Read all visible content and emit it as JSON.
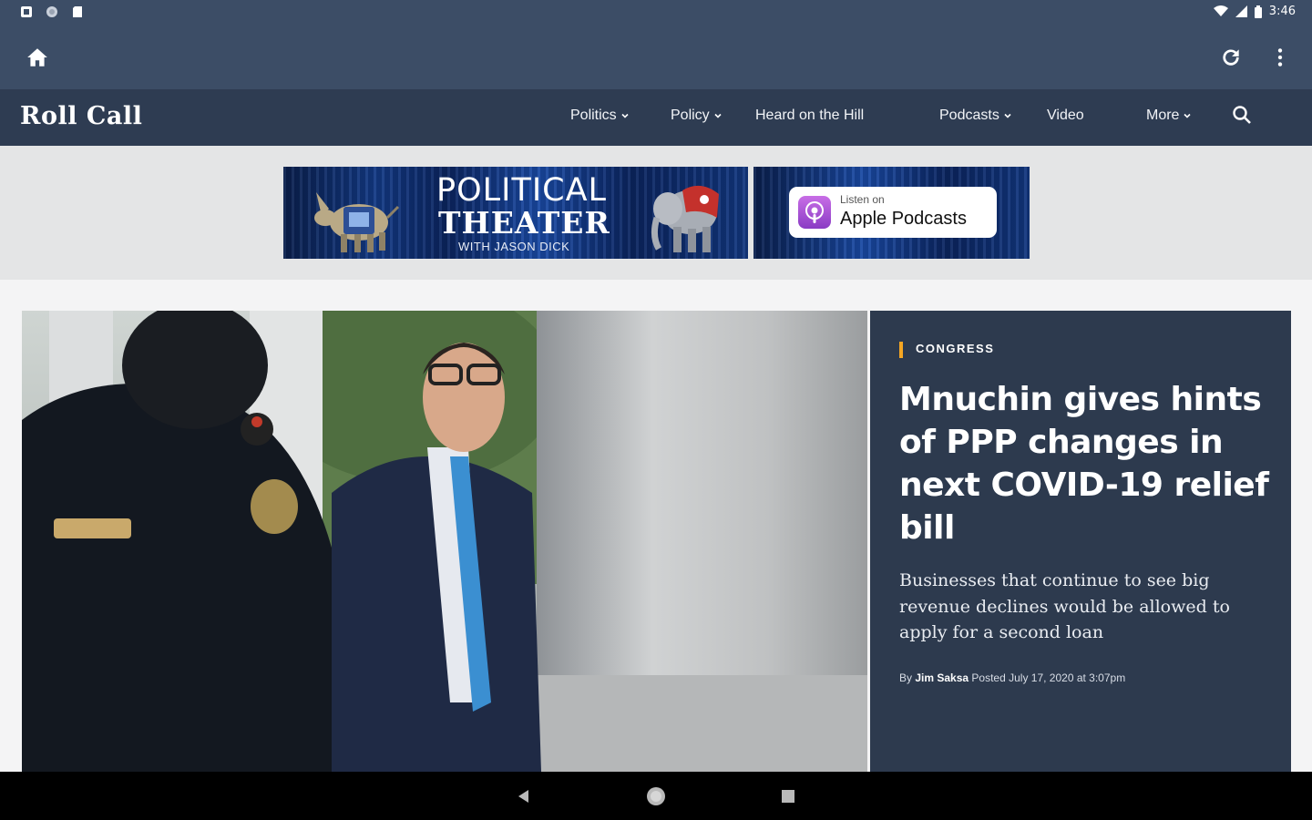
{
  "status_bar": {
    "time": "3:46",
    "left_icons": [
      "notification-icon",
      "circle-notification-icon",
      "sd-card-icon"
    ],
    "right_icons": [
      "wifi-icon",
      "signal-icon",
      "battery-icon"
    ]
  },
  "app_toolbar": {
    "icons": [
      "home-icon",
      "refresh-icon",
      "more-vert-icon"
    ],
    "color": "#3c4d66"
  },
  "site": {
    "logo": "Roll Call",
    "nav": [
      {
        "label": "Politics",
        "dropdown": true
      },
      {
        "label": "Policy",
        "dropdown": true
      },
      {
        "label": "Heard on the Hill",
        "dropdown": false
      },
      {
        "label": "Podcasts",
        "dropdown": true
      },
      {
        "label": "Video",
        "dropdown": false
      },
      {
        "label": "More",
        "dropdown": true
      }
    ],
    "nav_color": "#2e3c52"
  },
  "ad": {
    "title_line1": "POLITICAL",
    "title_line2": "THEATER",
    "title_line3": "WITH JASON DICK",
    "badge_small": "Listen on",
    "badge_big": "Apple Podcasts"
  },
  "hero": {
    "category": "CONGRESS",
    "headline": "Mnuchin gives hints of PPP changes in next COVID-19 relief bill",
    "dek": "Businesses that continue to see big revenue declines would be allowed to apply for a second loan",
    "byline_prefix": "By",
    "author": "Jim Saksa",
    "posted": "Posted July 17, 2020 at 3:07pm",
    "accent": "#f5a623",
    "card_color": "#2d3a4e"
  },
  "nav_bar": {
    "icons": [
      "back-icon",
      "home-circle-icon",
      "recents-icon"
    ]
  }
}
